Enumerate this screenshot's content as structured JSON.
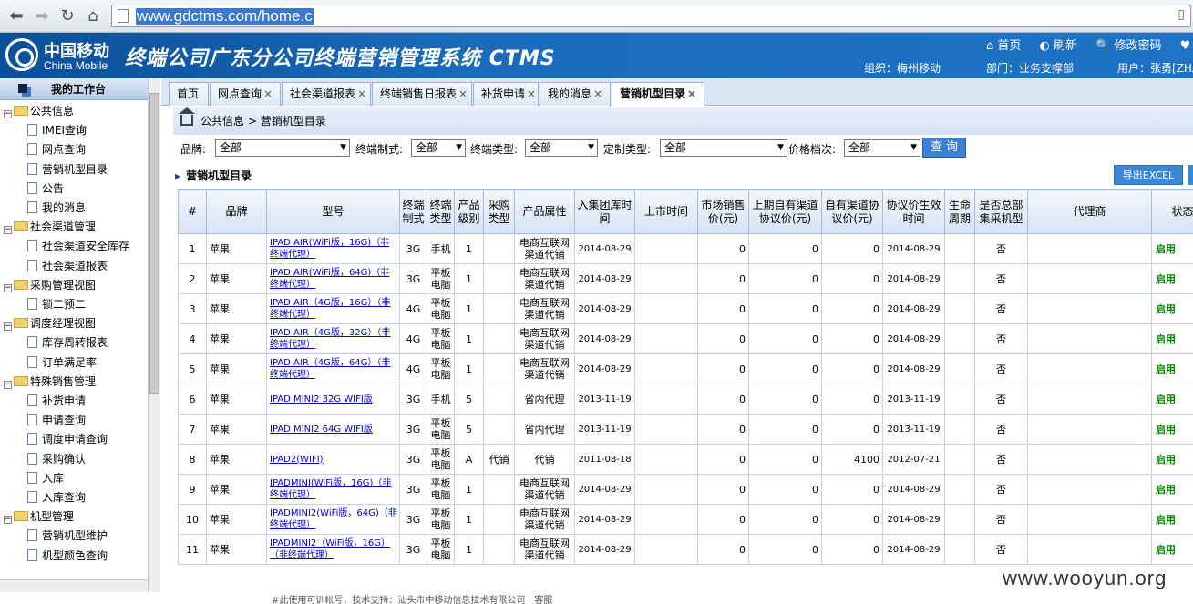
{
  "browser": {
    "url": "www.gdctms.com/home.c"
  },
  "header": {
    "logo_cn": "中国移动",
    "logo_en": "China Mobile",
    "title": "终端公司广东分公司终端营销管理系统 CTMS",
    "links": [
      "首页",
      "刷新",
      "修改密码",
      "帮助"
    ],
    "org": "组织：梅州移动",
    "dept": "部门：业务支撑部",
    "user": "用户：张勇[ZHA"
  },
  "sidebar": {
    "head": "我的工作台",
    "tree": [
      {
        "type": "folder",
        "label": "公共信息"
      },
      {
        "type": "leaf",
        "label": "IMEI查询"
      },
      {
        "type": "leaf",
        "label": "网点查询"
      },
      {
        "type": "leaf",
        "label": "营销机型目录"
      },
      {
        "type": "leaf",
        "label": "公告"
      },
      {
        "type": "leaf",
        "label": "我的消息"
      },
      {
        "type": "folder",
        "label": "社会渠道管理"
      },
      {
        "type": "leaf",
        "label": "社会渠道安全库存"
      },
      {
        "type": "leaf",
        "label": "社会渠道报表"
      },
      {
        "type": "folder",
        "label": "采购管理视图"
      },
      {
        "type": "leaf",
        "label": "锁二预二"
      },
      {
        "type": "folder",
        "label": "调度经理视图"
      },
      {
        "type": "leaf",
        "label": "库存周转报表"
      },
      {
        "type": "leaf",
        "label": "订单满足率"
      },
      {
        "type": "folder",
        "label": "特殊销售管理"
      },
      {
        "type": "leaf",
        "label": "补货申请"
      },
      {
        "type": "leaf",
        "label": "申请查询"
      },
      {
        "type": "leaf",
        "label": "调度申请查询"
      },
      {
        "type": "leaf",
        "label": "采购确认"
      },
      {
        "type": "leaf",
        "label": "入库"
      },
      {
        "type": "leaf",
        "label": "入库查询"
      },
      {
        "type": "folder",
        "label": "机型管理"
      },
      {
        "type": "leaf",
        "label": "营销机型维护"
      },
      {
        "type": "leaf",
        "label": "机型颜色查询"
      }
    ]
  },
  "tabs": [
    {
      "label": "首页",
      "closable": false
    },
    {
      "label": "网点查询",
      "closable": true
    },
    {
      "label": "社会渠道报表",
      "closable": true
    },
    {
      "label": "终端销售日报表",
      "closable": true
    },
    {
      "label": "补货申请",
      "closable": true
    },
    {
      "label": "我的消息",
      "closable": true
    },
    {
      "label": "营销机型目录",
      "closable": true,
      "active": true
    }
  ],
  "breadcrumb": {
    "part1": "公共信息",
    "sep": ">",
    "part2": "营销机型目录"
  },
  "filters": {
    "brand_label": "品牌:",
    "brand_value": "全部",
    "system_label": "终端制式:",
    "system_value": "全部",
    "type_label": "终端类型:",
    "type_value": "全部",
    "custom_label": "定制类型:",
    "custom_value": "全部",
    "price_label": "价格档次:",
    "price_value": "全部",
    "query_button": "查 询"
  },
  "list": {
    "title": "营销机型目录",
    "export_button": "导出EXCEL"
  },
  "table": {
    "columns": [
      "#",
      "品牌",
      "型号",
      "终端制式",
      "终端类型",
      "产品级别",
      "采购类型",
      "产品属性",
      "入集团库时间",
      "上市时间",
      "市场销售价(元)",
      "上期自有渠道协议价(元)",
      "自有渠道协议价(元)",
      "协议价生效时间",
      "生命周期",
      "是否总部集采机型",
      "代理商",
      "状态"
    ],
    "rows": [
      [
        "1",
        "苹果",
        "IPAD AIR(WiFi版，16G)（非终端代理）",
        "3G",
        "手机",
        "1",
        "",
        "电商互联网渠道代销",
        "2014-08-29",
        "",
        "0",
        "0",
        "0",
        "2014-08-29",
        "",
        "否",
        "",
        "启用"
      ],
      [
        "2",
        "苹果",
        "IPAD AIR(WiFi版，64G)（非终端代理）",
        "3G",
        "平板电脑",
        "1",
        "",
        "电商互联网渠道代销",
        "2014-08-29",
        "",
        "0",
        "0",
        "0",
        "2014-08-29",
        "",
        "否",
        "",
        "启用"
      ],
      [
        "3",
        "苹果",
        "IPAD AIR（4G版，16G）（非终端代理）",
        "4G",
        "平板电脑",
        "1",
        "",
        "电商互联网渠道代销",
        "2014-08-29",
        "",
        "0",
        "0",
        "0",
        "2014-08-29",
        "",
        "否",
        "",
        "启用"
      ],
      [
        "4",
        "苹果",
        "IPAD AIR（4G版，32G）（非终端代理）",
        "4G",
        "平板电脑",
        "1",
        "",
        "电商互联网渠道代销",
        "2014-08-29",
        "",
        "0",
        "0",
        "0",
        "2014-08-29",
        "",
        "否",
        "",
        "启用"
      ],
      [
        "5",
        "苹果",
        "IPAD AIR（4G版，64G）（非终端代理）",
        "4G",
        "平板电脑",
        "1",
        "",
        "电商互联网渠道代销",
        "2014-08-29",
        "",
        "0",
        "0",
        "0",
        "2014-08-29",
        "",
        "否",
        "",
        "启用"
      ],
      [
        "6",
        "苹果",
        "IPAD MINI2 32G WIFI版",
        "3G",
        "手机",
        "5",
        "",
        "省内代理",
        "2013-11-19",
        "",
        "0",
        "0",
        "0",
        "2013-11-19",
        "",
        "否",
        "",
        "启用"
      ],
      [
        "7",
        "苹果",
        "IPAD MINI2 64G WIFI版",
        "3G",
        "平板电脑",
        "5",
        "",
        "省内代理",
        "2013-11-19",
        "",
        "0",
        "0",
        "0",
        "2013-11-19",
        "",
        "否",
        "",
        "启用"
      ],
      [
        "8",
        "苹果",
        "IPAD2(WIFI)",
        "3G",
        "平板电脑",
        "A",
        "代销",
        "代销",
        "2011-08-18",
        "",
        "0",
        "0",
        "4100",
        "2012-07-21",
        "",
        "否",
        "",
        "启用"
      ],
      [
        "9",
        "苹果",
        "IPADMINI(WiFi版，16G)（非终端代理）",
        "3G",
        "平板电脑",
        "1",
        "",
        "电商互联网渠道代销",
        "2014-08-29",
        "",
        "0",
        "0",
        "0",
        "2014-08-29",
        "",
        "否",
        "",
        "启用"
      ],
      [
        "10",
        "苹果",
        "IPADMINI2(WiFi版，64G)（非终端代理）",
        "3G",
        "平板电脑",
        "1",
        "",
        "电商互联网渠道代销",
        "2014-08-29",
        "",
        "0",
        "0",
        "0",
        "2014-08-29",
        "",
        "否",
        "",
        "启用"
      ],
      [
        "11",
        "苹果",
        "IPADMINI2（WiFi版，16G）（非终端代理）",
        "3G",
        "平板电脑",
        "1",
        "",
        "电商互联网渠道代销",
        "2014-08-29",
        "",
        "0",
        "0",
        "0",
        "2014-08-29",
        "",
        "否",
        "",
        "启用"
      ]
    ]
  },
  "footer": {
    "text": "#此使用可训帐号，技术支持：汕头市中移动信息技术有限公司　客服"
  },
  "watermark": "www.wooyun.org",
  "colors": {
    "header_blue": "#1a6bbb",
    "status_green": "#008800",
    "link_blue": "#0000cc"
  }
}
